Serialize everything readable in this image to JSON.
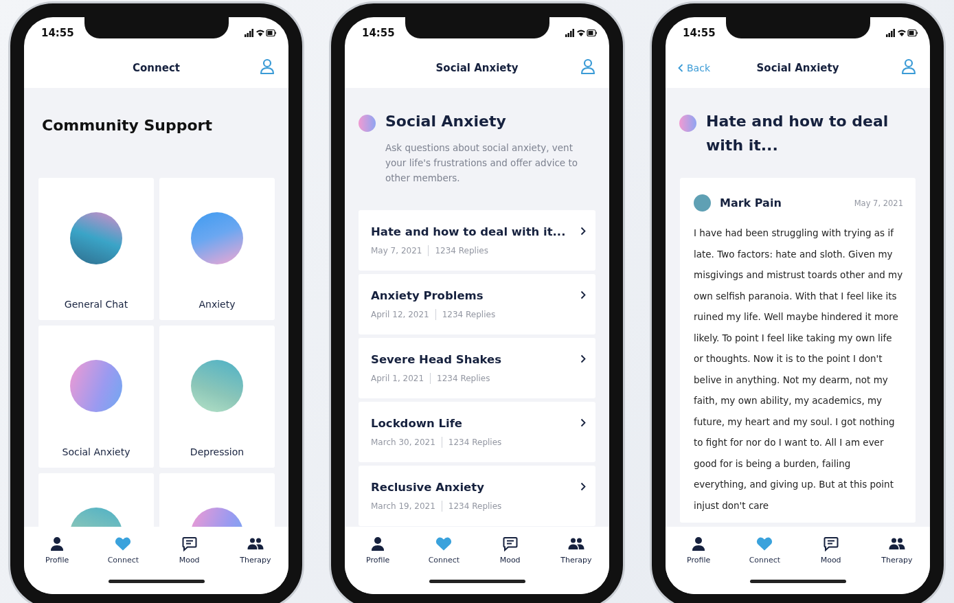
{
  "phones": [
    {
      "kind": "categories",
      "status_time": "14:55",
      "nav": {
        "title": "Connect"
      },
      "heading": "Community Support",
      "categories": [
        {
          "kind": "card",
          "label": "General Chat"
        },
        {
          "kind": "card",
          "label": "Anxiety"
        },
        {
          "kind": "card",
          "label": "Social Anxiety"
        },
        {
          "kind": "card",
          "label": "Depression"
        },
        {
          "kind": "partial"
        },
        {
          "kind": "partial"
        }
      ],
      "tabs": [
        {
          "kind": "profile",
          "label": "Profile",
          "selected": false
        },
        {
          "kind": "connect",
          "label": "Connect",
          "selected": true
        },
        {
          "kind": "mood",
          "label": "Mood",
          "selected": false
        },
        {
          "kind": "therapy",
          "label": "Therapy",
          "selected": false
        }
      ]
    },
    {
      "kind": "threads",
      "status_time": "14:55",
      "nav": {
        "title": "Social Anxiety"
      },
      "heading": "Social Anxiety",
      "description": "Ask questions about social anxiety, vent your life's frustrations and offer advice to other members.",
      "threads": [
        {
          "title": "Hate and how to deal with it...",
          "date": "May 7, 2021",
          "replies": "1234 Replies"
        },
        {
          "title": "Anxiety Problems",
          "date": "April 12, 2021",
          "replies": "1234 Replies"
        },
        {
          "title": "Severe Head Shakes",
          "date": "April 1, 2021",
          "replies": "1234 Replies"
        },
        {
          "title": "Lockdown Life",
          "date": "March 30, 2021",
          "replies": "1234 Replies"
        },
        {
          "title": "Reclusive Anxiety",
          "date": "March 19, 2021",
          "replies": "1234 Replies"
        }
      ],
      "tabs": [
        {
          "kind": "profile",
          "label": "Profile",
          "selected": false
        },
        {
          "kind": "connect",
          "label": "Connect",
          "selected": true
        },
        {
          "kind": "mood",
          "label": "Mood",
          "selected": false
        },
        {
          "kind": "therapy",
          "label": "Therapy",
          "selected": false
        }
      ]
    },
    {
      "kind": "post",
      "status_time": "14:55",
      "nav": {
        "back": "Back",
        "title": "Social Anxiety"
      },
      "heading": "Hate and how to deal with it...",
      "post": {
        "author": "Mark Pain",
        "date": "May 7, 2021",
        "body": "I have had been struggling with trying as if late. Two factors: hate and sloth. Given my misgivings and mistrust toards other and my own selfish paranoia. With that I feel like its ruined my life. Well maybe hindered it more likely. To point I feel like taking my own life or thoughts. Now it is to the point I don't belive in anything. Not my dearm, not my faith, my own ability, my academics, my future, my heart and my soul. I got nothing to fight for nor do I want to. All I am ever good for is being a burden, failing everything, and giving up. But at this point injust don't care"
      },
      "tabs": [
        {
          "kind": "profile",
          "label": "Profile",
          "selected": false
        },
        {
          "kind": "connect",
          "label": "Connect",
          "selected": true
        },
        {
          "kind": "mood",
          "label": "Mood",
          "selected": false
        },
        {
          "kind": "therapy",
          "label": "Therapy",
          "selected": false
        }
      ]
    }
  ]
}
